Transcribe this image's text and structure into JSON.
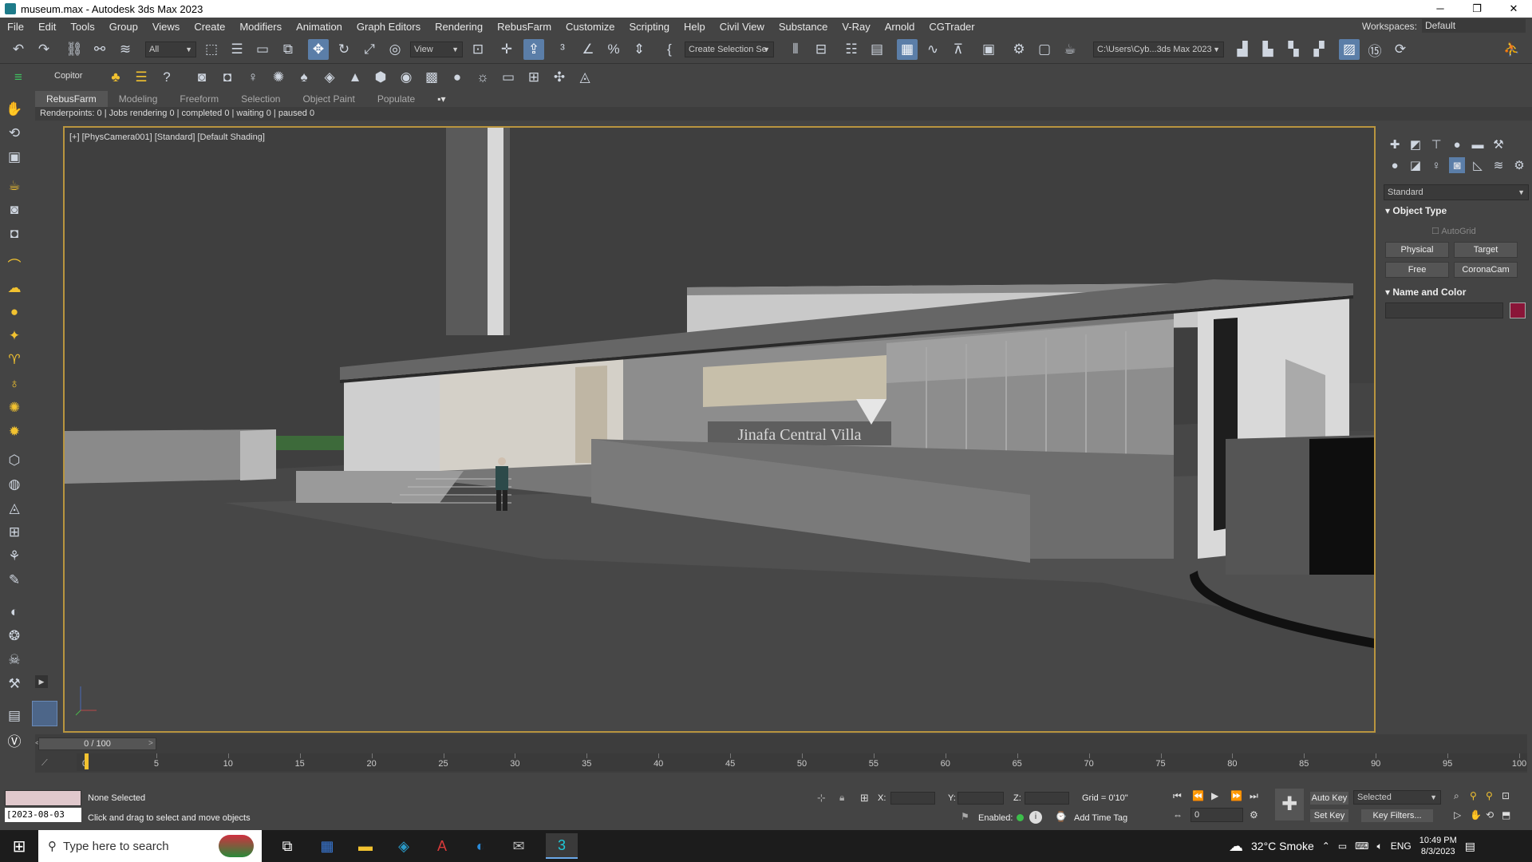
{
  "window": {
    "title": "museum.max - Autodesk 3ds Max 2023",
    "minimize": "─",
    "maximize": "❐",
    "close": "✕"
  },
  "menu": [
    "File",
    "Edit",
    "Tools",
    "Group",
    "Views",
    "Create",
    "Modifiers",
    "Animation",
    "Graph Editors",
    "Rendering",
    "RebusFarm",
    "Customize",
    "Scripting",
    "Help",
    "Civil View",
    "Substance",
    "V-Ray",
    "Arnold",
    "CGTrader"
  ],
  "workspace": {
    "label": "Workspaces:",
    "value": "Default"
  },
  "toolbar": {
    "filter_value": "All",
    "refcoord_value": "View",
    "selection_set_placeholder": "Create Selection Se",
    "path_value": "C:\\Users\\Cyb...3ds Max 2023",
    "copitor_label": "Copitor"
  },
  "ribbon_tabs": [
    "RebusFarm",
    "Modeling",
    "Freeform",
    "Selection",
    "Object Paint",
    "Populate"
  ],
  "render_status": "Renderpoints: 0 | Jobs rendering 0 | completed 0 | waiting 0 | paused 0",
  "viewport": {
    "label": "[+] [PhysCamera001] [Standard] [Default Shading]",
    "sign_text": "Jinafa Central Villa"
  },
  "command_panel": {
    "category": "Standard",
    "rollout_object_type": "Object Type",
    "autogrid": "AutoGrid",
    "buttons": [
      "Physical",
      "Target",
      "Free",
      "CoronaCam"
    ],
    "rollout_name_color": "Name and Color",
    "object_color": "#8a1538"
  },
  "timeline": {
    "frame_display": "0 / 100",
    "ticks": [
      0,
      5,
      10,
      15,
      20,
      25,
      30,
      35,
      40,
      45,
      50,
      55,
      60,
      65,
      70,
      75,
      80,
      85,
      90,
      95,
      100
    ]
  },
  "status": {
    "selection": "None Selected",
    "prompt": "Click and drag to select and move objects",
    "date_field": "[2023-08-03",
    "x_label": "X:",
    "y_label": "Y:",
    "z_label": "Z:",
    "grid": "Grid = 0'10\"",
    "enabled": "Enabled:",
    "add_time_tag": "Add Time Tag",
    "auto_key": "Auto Key",
    "selected_value": "Selected",
    "set_key": "Set Key",
    "key_filters": "Key Filters...",
    "frame_value": "0"
  },
  "taskbar": {
    "search_placeholder": "Type here to search",
    "weather": "32°C  Smoke",
    "lang": "ENG",
    "time": "10:49 PM",
    "date": "8/3/2023"
  }
}
